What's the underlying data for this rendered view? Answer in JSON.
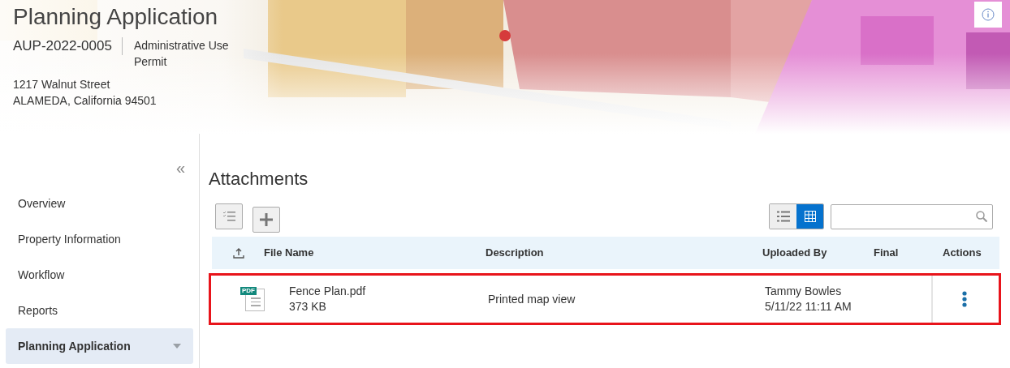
{
  "header": {
    "title": "Planning Application",
    "record_id": "AUP-2022-0005",
    "record_type": "Administrative Use Permit",
    "address_line_1": "1217 Walnut Street",
    "address_line_2": "ALAMEDA, California 94501"
  },
  "sidebar": {
    "collapse_glyph": "«",
    "items": [
      {
        "label": "Overview",
        "selected": false,
        "expandable": false
      },
      {
        "label": "Property Information",
        "selected": false,
        "expandable": false
      },
      {
        "label": "Workflow",
        "selected": false,
        "expandable": false
      },
      {
        "label": "Reports",
        "selected": false,
        "expandable": false
      },
      {
        "label": "Planning Application",
        "selected": true,
        "expandable": true
      }
    ]
  },
  "attachments": {
    "title": "Attachments",
    "views": [
      {
        "kind": "list",
        "selected": false
      },
      {
        "kind": "grid",
        "selected": true
      }
    ],
    "columns": [
      "File Name",
      "Description",
      "Uploaded By",
      "Final",
      "Actions"
    ],
    "rows": [
      {
        "file_type": "PDF",
        "file_name": "Fence Plan.pdf",
        "size": "373 KB",
        "description": "Printed map view",
        "uploaded_by": "Tammy Bowles",
        "uploaded_at": "5/11/22 11:11 AM",
        "selected": true
      }
    ]
  }
}
